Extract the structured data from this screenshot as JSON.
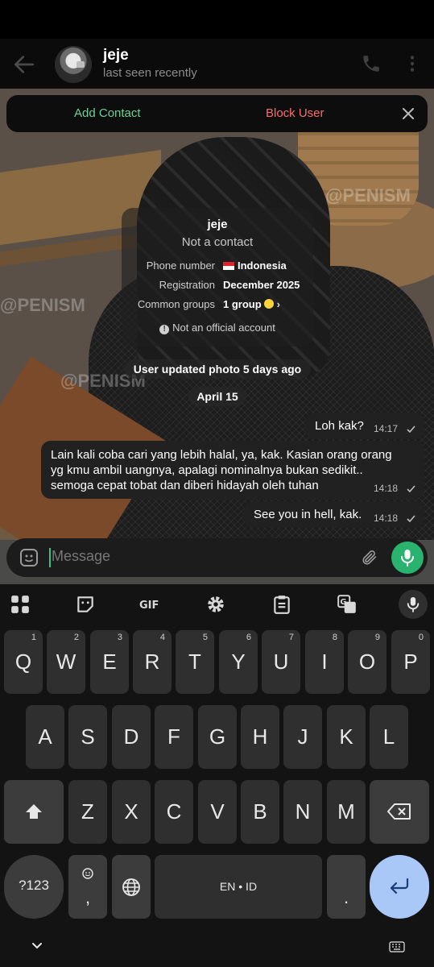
{
  "header": {
    "title": "jeje",
    "subtitle": "last seen recently"
  },
  "contact_bar": {
    "add_label": "Add Contact",
    "block_label": "Block User"
  },
  "info_card": {
    "name": "jeje",
    "status": "Not a contact",
    "rows": [
      {
        "label": "Phone number",
        "value": "Indonesia"
      },
      {
        "label": "Registration",
        "value": "December 2025"
      },
      {
        "label": "Common groups",
        "value": "1 group"
      }
    ],
    "note": "Not an official account"
  },
  "service": {
    "photo_update": "User updated photo 5 days ago",
    "date": "April 15"
  },
  "messages": [
    {
      "text": "Loh kak?",
      "time": "14:17"
    },
    {
      "lines": [
        "Lain kali coba cari yang lebih halal, ya, kak. Kasian orang orang",
        "yg kmu ambil uangnya, apalagi nominalnya bukan sedikit..",
        "semoga cepat tobat dan diberi hidayah oleh tuhan"
      ],
      "time": "14:18"
    },
    {
      "text": "See you in hell, kak.",
      "time": "14:18"
    }
  ],
  "composer": {
    "placeholder": "Message"
  },
  "keyboard": {
    "row1": [
      {
        "k": "Q",
        "n": "1"
      },
      {
        "k": "W",
        "n": "2"
      },
      {
        "k": "E",
        "n": "3"
      },
      {
        "k": "R",
        "n": "4"
      },
      {
        "k": "T",
        "n": "5"
      },
      {
        "k": "Y",
        "n": "6"
      },
      {
        "k": "U",
        "n": "7"
      },
      {
        "k": "I",
        "n": "8"
      },
      {
        "k": "O",
        "n": "9"
      },
      {
        "k": "P",
        "n": "0"
      }
    ],
    "row2": [
      "A",
      "S",
      "D",
      "F",
      "G",
      "H",
      "J",
      "K",
      "L"
    ],
    "row3": [
      "Z",
      "X",
      "C",
      "V",
      "B",
      "N",
      "M"
    ],
    "symbols_label": "?123",
    "comma_label": ",",
    "space_label": "EN • ID",
    "period_label": "."
  },
  "wallpaper_tags": [
    "@PENISM",
    "@PENISM",
    "@PENISM"
  ],
  "colors": {
    "accent_green": "#2ab36f",
    "add_contact": "#6fd199",
    "block_user": "#ff6b6b",
    "enter_key": "#a9c8f8"
  }
}
